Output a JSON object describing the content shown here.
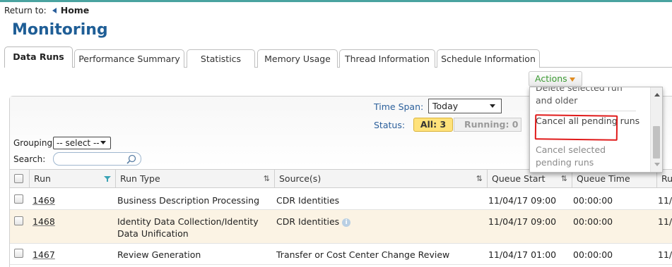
{
  "return_bar": {
    "label": "Return to:",
    "home": "Home"
  },
  "page_title": "Monitoring",
  "tabs": [
    {
      "label": "Data Runs",
      "active": true
    },
    {
      "label": "Performance Summary",
      "active": false
    },
    {
      "label": "Statistics",
      "active": false
    },
    {
      "label": "Memory Usage",
      "active": false
    },
    {
      "label": "Thread Information",
      "active": false
    },
    {
      "label": "Schedule Information",
      "active": false
    }
  ],
  "actions": {
    "label": "Actions",
    "menu": [
      {
        "label": "Delete selected run and older",
        "visible_text": "and older"
      },
      {
        "label": "Cancel all pending runs",
        "highlighted": true
      },
      {
        "label": "Cancel selected pending runs",
        "disabled": true
      }
    ]
  },
  "filters": {
    "time_span_label": "Time Span:",
    "time_span_value": "Today",
    "status_label": "Status:",
    "status_all": "All: 3",
    "status_running": "Running: 0",
    "grouping_label": "Grouping:",
    "grouping_value": "-- select --",
    "search_label": "Search:",
    "search_value": ""
  },
  "table": {
    "columns": [
      "Run",
      "Run Type",
      "Source(s)",
      "Queue Start",
      "Queue Time",
      "Ru"
    ],
    "rows": [
      {
        "run": "1469",
        "run_type": "Business Description Processing",
        "sources": "CDR Identities",
        "queue_start": "11/04/17 09:00",
        "queue_time": "00:00:00",
        "ru": "11/"
      },
      {
        "run": "1468",
        "run_type": "Identity Data Collection/Identity Data Unification",
        "sources": "CDR Identities",
        "queue_start": "11/04/17 09:00",
        "queue_time": "00:00:00",
        "ru": "11/"
      },
      {
        "run": "1467",
        "run_type": "Review Generation",
        "sources": "Transfer or Cost Center Change Review",
        "queue_start": "11/04/17 01:00",
        "queue_time": "00:00:00",
        "ru": "11/"
      }
    ]
  },
  "colors": {
    "title": "#1f5e96",
    "accent_link": "#2b5f9b",
    "actions_text": "#3b9a32",
    "status_all_bg": "#ffe27a",
    "alt_row_bg": "#fbf3e4",
    "highlight_outline": "#e01b1b"
  },
  "icons": [
    "back-arrow-icon",
    "search-icon",
    "filter-icon",
    "sort-icon",
    "info-icon",
    "dropdown-arrow-icon"
  ]
}
